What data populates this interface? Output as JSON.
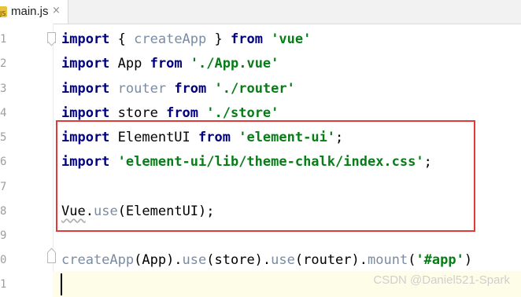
{
  "tab": {
    "file_icon_text": "JS",
    "file_name": "main.js",
    "close_glyph": "×"
  },
  "gutter": {
    "line_numbers": [
      "1",
      "2",
      "3",
      "4",
      "5",
      "6",
      "7",
      "8",
      "9",
      "0",
      "1"
    ]
  },
  "code": {
    "line1": {
      "kw": "import",
      "text1": " { ",
      "ident": "createApp",
      "text2": " } ",
      "kw2": "from",
      "space": " ",
      "str": "'vue'"
    },
    "line2": {
      "kw": "import",
      "ident": " App ",
      "kw2": "from",
      "space": " ",
      "str": "'./App.vue'"
    },
    "line3": {
      "kw": "import",
      "ident": " router ",
      "kw2": "from",
      "space": " ",
      "str": "'./router'"
    },
    "line4": {
      "kw": "import",
      "ident": " store ",
      "kw2": "from",
      "space": " ",
      "str": "'./store'"
    },
    "line5": {
      "kw": "import",
      "ident": " ElementUI ",
      "kw2": "from",
      "space": " ",
      "str": "'element-ui'",
      "end": ";"
    },
    "line6": {
      "kw": "import",
      "space": " ",
      "str": "'element-ui/lib/theme-chalk/index.css'",
      "end": ";"
    },
    "line8": {
      "obj": "Vue",
      "dot": ".",
      "fn": "use",
      "args": "(ElementUI);"
    },
    "line10": {
      "fn1": "createApp",
      "arg1": "(App).",
      "fn2": "use",
      "arg2": "(store).",
      "fn3": "use",
      "arg3": "(router).",
      "fn4": "mount",
      "open": "(",
      "str": "'#app'",
      "close": ")"
    }
  },
  "watermark": "CSDN @Daniel521-Spark",
  "colors": {
    "keyword": "#000080",
    "string": "#067d17",
    "highlight_border": "#e03a3a",
    "current_line": "#fefde8"
  }
}
